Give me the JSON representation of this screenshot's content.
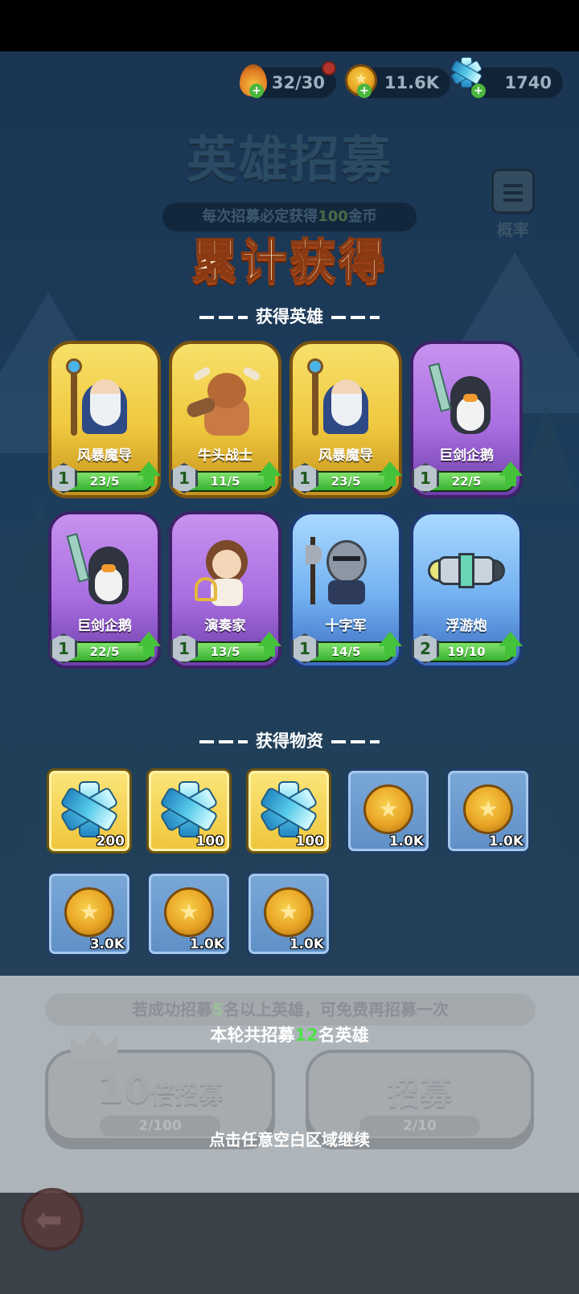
{
  "resources": {
    "energy": "32/30",
    "gold": "11.6K",
    "gems": "1740"
  },
  "header": {
    "title": "英雄招募",
    "subtitle_pre": "每次招募必定获得",
    "subtitle_num": "100",
    "subtitle_post": "金币",
    "odds_label": "概率"
  },
  "result": {
    "title": "累计获得",
    "heroes_section": "获得英雄",
    "items_section": "获得物资"
  },
  "heroes": [
    {
      "name": "风暴魔导",
      "level": "1",
      "progress": "23/5",
      "rarity": "gold",
      "icon": "mage-portrait-icon",
      "fill": 1.0
    },
    {
      "name": "牛头战士",
      "level": "1",
      "progress": "11/5",
      "rarity": "gold",
      "icon": "minotaur-portrait-icon",
      "fill": 1.0
    },
    {
      "name": "风暴魔导",
      "level": "1",
      "progress": "23/5",
      "rarity": "gold",
      "icon": "mage-portrait-icon",
      "fill": 1.0
    },
    {
      "name": "巨剑企鹅",
      "level": "1",
      "progress": "22/5",
      "rarity": "purple",
      "icon": "penguin-portrait-icon",
      "fill": 1.0
    },
    {
      "name": "巨剑企鹅",
      "level": "1",
      "progress": "22/5",
      "rarity": "purple",
      "icon": "penguin-portrait-icon",
      "fill": 1.0
    },
    {
      "name": "演奏家",
      "level": "1",
      "progress": "13/5",
      "rarity": "purple",
      "icon": "bard-portrait-icon",
      "fill": 1.0
    },
    {
      "name": "十字军",
      "level": "1",
      "progress": "14/5",
      "rarity": "blue",
      "icon": "crusader-portrait-icon",
      "fill": 1.0
    },
    {
      "name": "浮游炮",
      "level": "2",
      "progress": "19/10",
      "rarity": "blue",
      "icon": "floating-cannon-portrait-icon",
      "fill": 1.0
    }
  ],
  "items": [
    {
      "qty": "200",
      "type": "gem",
      "rarity": "gold"
    },
    {
      "qty": "100",
      "type": "gem",
      "rarity": "gold"
    },
    {
      "qty": "100",
      "type": "gem",
      "rarity": "gold"
    },
    {
      "qty": "1.0K",
      "type": "coin",
      "rarity": "blue"
    },
    {
      "qty": "1.0K",
      "type": "coin",
      "rarity": "blue"
    },
    {
      "qty": "3.0K",
      "type": "coin",
      "rarity": "blue"
    },
    {
      "qty": "1.0K",
      "type": "coin",
      "rarity": "blue"
    },
    {
      "qty": "1.0K",
      "type": "coin",
      "rarity": "blue"
    }
  ],
  "panel": {
    "hint_pre": "若成功招募",
    "hint_num": "5",
    "hint_post": "名以上英雄，可免费再招募一次",
    "summary_pre": "本轮共招募",
    "summary_num": "12",
    "summary_post": "名英雄",
    "multi_num": "10",
    "multi_label": "倍招募",
    "multi_count": "2/100",
    "single_label": "招募",
    "single_count": "2/10",
    "continue": "点击任意空白区域继续"
  },
  "colors": {
    "gold_rarity": "#efc83e",
    "purple_rarity": "#a96ee0",
    "blue_rarity": "#72b0f0",
    "progress_green": "#44c23a",
    "title_orange": "#a4461a"
  }
}
